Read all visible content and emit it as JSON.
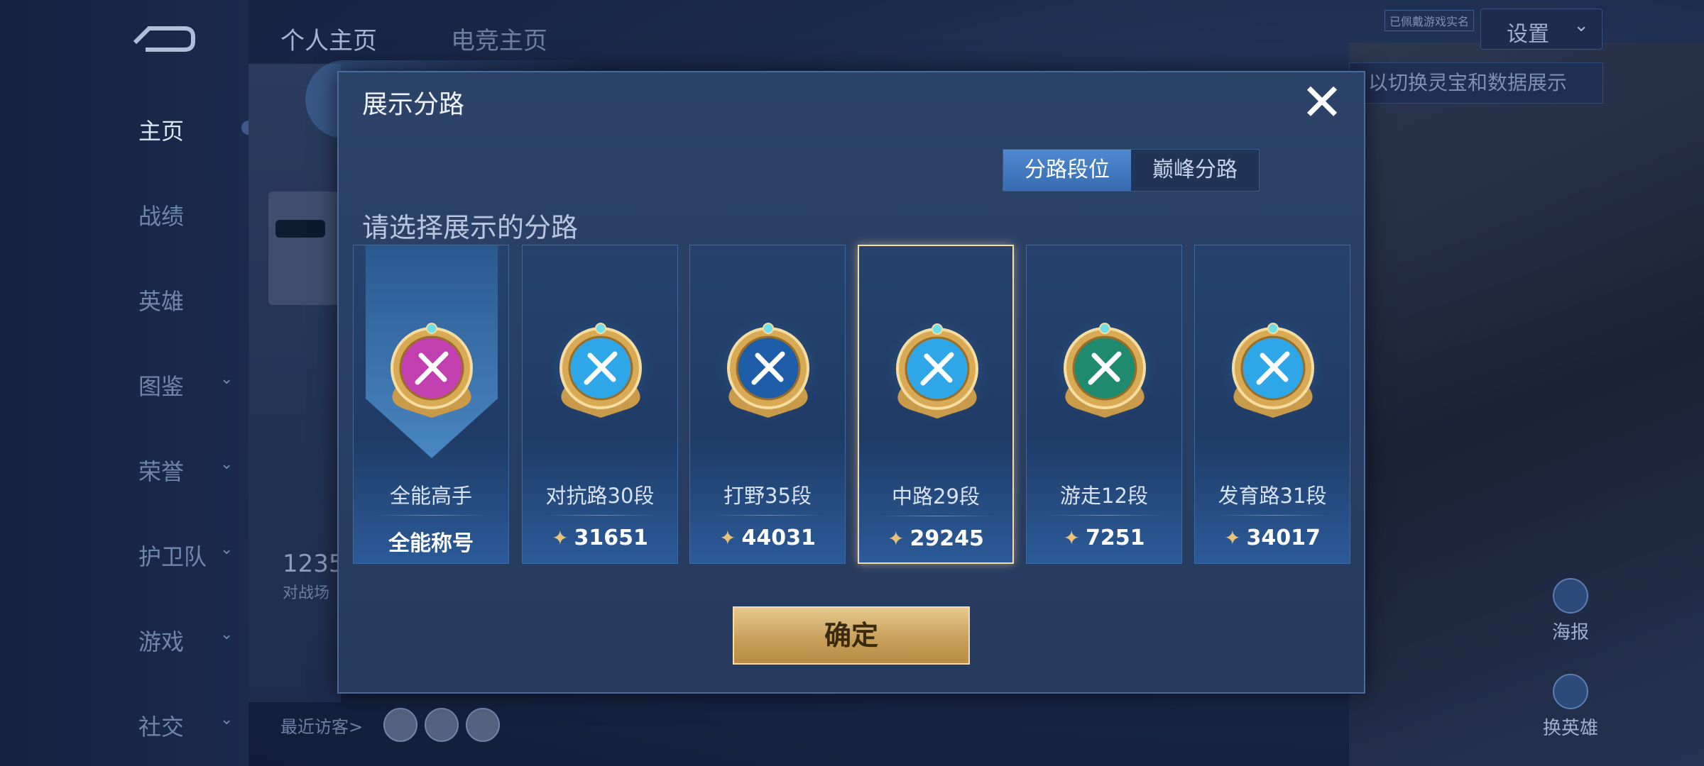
{
  "sidebar": {
    "items": [
      {
        "label": "主页",
        "active": true,
        "has_chevron": false
      },
      {
        "label": "战绩",
        "active": false,
        "has_chevron": false
      },
      {
        "label": "英雄",
        "active": false,
        "has_chevron": false
      },
      {
        "label": "图鉴",
        "active": false,
        "has_chevron": true
      },
      {
        "label": "荣誉",
        "active": false,
        "has_chevron": true
      },
      {
        "label": "护卫队",
        "active": false,
        "has_chevron": true
      },
      {
        "label": "游戏",
        "active": false,
        "has_chevron": true
      },
      {
        "label": "社交",
        "active": false,
        "has_chevron": true
      }
    ]
  },
  "header": {
    "tabs": [
      "个人主页",
      "电竞主页"
    ],
    "settings_label": "设置",
    "verify_badge": "已佩戴游戏实名",
    "hint": "以切换灵宝和数据展示"
  },
  "background": {
    "stat_value": "1235",
    "stat_label": "对战场",
    "visitors_label": "最近访客>",
    "right_actions": [
      "海报",
      "换英雄"
    ]
  },
  "modal": {
    "title": "展示分路",
    "close_glyph": "✕",
    "segments": [
      "分路段位",
      "巅峰分路"
    ],
    "active_segment": 0,
    "subtitle": "请选择展示的分路",
    "confirm_label": "确定",
    "lanes": [
      {
        "name": "全能高手",
        "score": "全能称号",
        "badge": "all-round-badge-icon",
        "badge_color": "#c23fb0",
        "selected": false,
        "is_title": true
      },
      {
        "name": "对抗路30段",
        "score": "31651",
        "badge": "clash-lane-badge-icon",
        "badge_color": "#2fa6e8",
        "selected": false,
        "is_title": false
      },
      {
        "name": "打野35段",
        "score": "44031",
        "badge": "jungle-badge-icon",
        "badge_color": "#1e5ea8",
        "selected": false,
        "is_title": false
      },
      {
        "name": "中路29段",
        "score": "29245",
        "badge": "mid-lane-badge-icon",
        "badge_color": "#2fa6e8",
        "selected": true,
        "is_title": false
      },
      {
        "name": "游走12段",
        "score": "7251",
        "badge": "roam-badge-icon",
        "badge_color": "#1f8a6e",
        "selected": false,
        "is_title": false
      },
      {
        "name": "发育路31段",
        "score": "34017",
        "badge": "farm-lane-badge-icon",
        "badge_color": "#2fa6e8",
        "selected": false,
        "is_title": false
      }
    ]
  },
  "colors": {
    "gold": "#d8b26a",
    "selected_border": "#f5d9a6",
    "segment_active": "#4f89cf"
  }
}
